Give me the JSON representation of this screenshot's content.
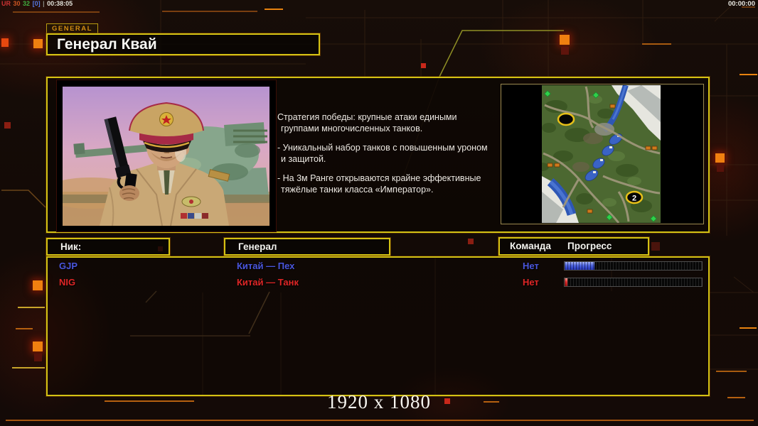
{
  "hud": {
    "status_left": {
      "part1": "UR",
      "part2": "30",
      "part3": "32",
      "part4": "[0]",
      "sep": "|",
      "clock": "00:38:05"
    },
    "match_timer": "00:00:00",
    "resolution": "1920 x 1080"
  },
  "header": {
    "tab_label": "GENERAL",
    "title": "Генерал Квай"
  },
  "strategy": {
    "lines": [
      "Стратегия победы: крупные атаки едиными",
      "группами многочисленных танков.",
      "- Уникальный набор танков с повышенным уроном",
      "и защитой.",
      "- На 3м Ранге открываются крайне эффективные",
      "тяжёлые танки класса «Император»."
    ]
  },
  "minimap": {
    "start_positions": [
      {
        "label": ""
      },
      {
        "label": "2"
      }
    ]
  },
  "roster": {
    "headers": {
      "nick": "Ник:",
      "general": "Генерал",
      "team": "Команда",
      "progress": "Прогресс"
    },
    "rows": [
      {
        "nick": "GJP",
        "general": "Китай — Пех",
        "team": "Нет",
        "progress_pct": 22,
        "color": "#4a56dd"
      },
      {
        "nick": "NIG",
        "general": "Китай — Танк",
        "team": "Нет",
        "progress_pct": 2,
        "color": "#df2626"
      }
    ]
  },
  "colors": {
    "panel_border": "#d3c214",
    "accent_orange": "#f08010",
    "blue_player": "#4a56dd",
    "red_player": "#df2626"
  }
}
